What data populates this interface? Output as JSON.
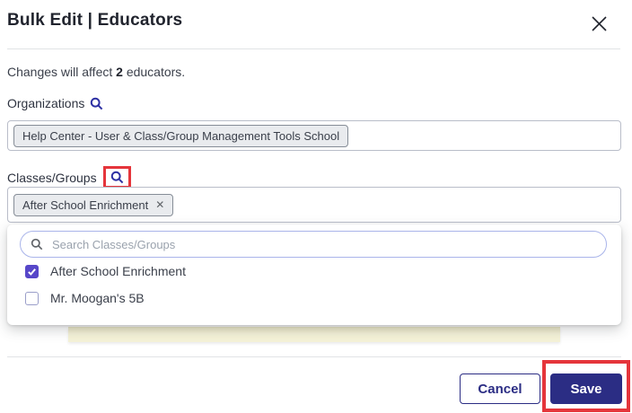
{
  "colors": {
    "navy": "#2b2d84",
    "indigo-icon": "#2d30a3",
    "checkbox-purple": "#5747c9",
    "annotation-red": "#e5353b",
    "chip-bg": "#e9ebee",
    "chip-border": "#868d97",
    "input-border": "#b9bdc9",
    "pill-border": "#a9b4ea",
    "warning-yellow": "#f4f1d6",
    "text-dark": "#21242e",
    "text-body": "#3a3f4a",
    "placeholder-gray": "#9aa2ad"
  },
  "modal": {
    "title": "Bulk Edit | Educators",
    "subtitle": {
      "prefix": "Changes will affect",
      "count": "2",
      "suffix": "educators."
    }
  },
  "organizations": {
    "label": "Organizations",
    "chips": [
      "Help Center - User & Class/Group Management Tools School"
    ]
  },
  "classes_groups": {
    "label": "Classes/Groups",
    "chips": [
      {
        "label": "After School Enrichment",
        "removable": true
      }
    ]
  },
  "dropdown": {
    "search_placeholder": "Search Classes/Groups",
    "options": [
      {
        "label": "After School Enrichment",
        "checked": true
      },
      {
        "label": "Mr. Moogan's 5B",
        "checked": false
      }
    ]
  },
  "footer": {
    "cancel_label": "Cancel",
    "save_label": "Save"
  }
}
